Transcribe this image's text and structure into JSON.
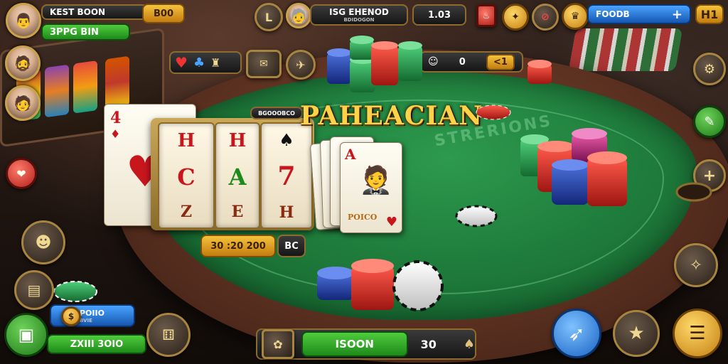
{
  "player": {
    "name": "KEST BOON",
    "balance": "3PPG BIN",
    "bet_value": "B00"
  },
  "top_bar": {
    "level_label": "L",
    "opponent_name": "ISG EHENOD",
    "opponent_sub": "BDIDOGON",
    "pot_value": "1.03",
    "wallet_label": "FOODB",
    "wallet_plus": "+",
    "hi_label": "H1"
  },
  "table": {
    "title": "PAHEACIAN",
    "seat_label": "0",
    "seat_btn": "<1",
    "felt_caption": "STRERIONS",
    "sign_plate": "BGOOOBCO",
    "card_caption": "POICO",
    "bet_amount": "30 :20 200",
    "bet_icon": "BC"
  },
  "reels": [
    [
      "H",
      "C",
      "Z"
    ],
    [
      "H",
      "A",
      "E"
    ],
    [
      "♠",
      "7",
      "H"
    ]
  ],
  "cards": {
    "back_rank": "4",
    "front_rank": "A"
  },
  "left_panel": {
    "promo_label": "POIIO",
    "promo_sub": "BVIE",
    "bottom_bar": "ZXIII 3OIO"
  },
  "bottom_bar": {
    "center_label": "ISOON",
    "count": "30",
    "icon_left": "chip-icon",
    "icon_right": "spade-icon"
  },
  "colors": {
    "felt": "#1f7d3c",
    "rail": "#5a3020",
    "gold": "#f5c33b",
    "green": "#1e8a1a"
  }
}
